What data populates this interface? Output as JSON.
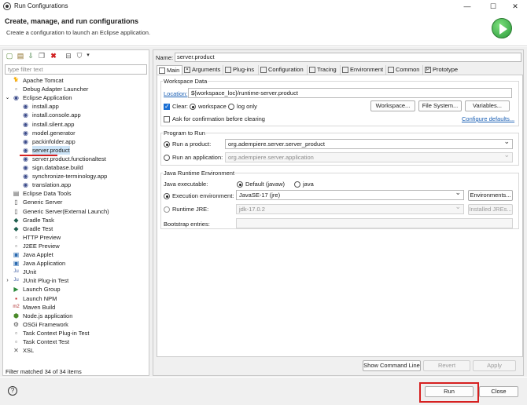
{
  "window": {
    "title": "Run Configurations",
    "controls": [
      "—",
      "☐",
      "✕"
    ]
  },
  "header": {
    "title": "Create, manage, and run configurations",
    "description": "Create a configuration to launch an Eclipse application."
  },
  "left_panel": {
    "filter_placeholder": "type filter text",
    "status": "Filter matched 34 of 34 items",
    "tree": [
      {
        "label": "Apache Tomcat",
        "level": 1,
        "icon": "tomcat-icon",
        "glyph": "🐈"
      },
      {
        "label": "Debug Adapter Launcher",
        "level": 1,
        "icon": "debug-adapter-icon",
        "glyph": "▫"
      },
      {
        "label": "Eclipse Application",
        "level": 1,
        "icon": "eclipse-icon",
        "glyph": "◉",
        "expanded": true
      },
      {
        "label": "install.app",
        "level": 2,
        "icon": "eclipse-icon",
        "glyph": "◉"
      },
      {
        "label": "install.console.app",
        "level": 2,
        "icon": "eclipse-icon",
        "glyph": "◉"
      },
      {
        "label": "install.silent.app",
        "level": 2,
        "icon": "eclipse-icon",
        "glyph": "◉"
      },
      {
        "label": "model.generator",
        "level": 2,
        "icon": "eclipse-icon",
        "glyph": "◉"
      },
      {
        "label": "packinfolder.app",
        "level": 2,
        "icon": "eclipse-icon",
        "glyph": "◉"
      },
      {
        "label": "server.product",
        "level": 2,
        "icon": "eclipse-icon",
        "glyph": "◉",
        "selected": true
      },
      {
        "label": "server.product.functionaltest",
        "level": 2,
        "icon": "eclipse-icon",
        "glyph": "◉"
      },
      {
        "label": "sign.database.build",
        "level": 2,
        "icon": "eclipse-icon",
        "glyph": "◉"
      },
      {
        "label": "synchronize-terminology.app",
        "level": 2,
        "icon": "eclipse-icon",
        "glyph": "◉"
      },
      {
        "label": "translation.app",
        "level": 2,
        "icon": "eclipse-icon",
        "glyph": "◉"
      },
      {
        "label": "Eclipse Data Tools",
        "level": 1,
        "icon": "data-tools-icon",
        "glyph": "▤"
      },
      {
        "label": "Generic Server",
        "level": 1,
        "icon": "server-icon",
        "glyph": "▯"
      },
      {
        "label": "Generic Server(External Launch)",
        "level": 1,
        "icon": "server-icon",
        "glyph": "▯"
      },
      {
        "label": "Gradle Task",
        "level": 1,
        "icon": "gradle-icon",
        "glyph": "◆"
      },
      {
        "label": "Gradle Test",
        "level": 1,
        "icon": "gradle-icon",
        "glyph": "◆"
      },
      {
        "label": "HTTP Preview",
        "level": 1,
        "icon": "http-preview-icon",
        "glyph": "▫"
      },
      {
        "label": "J2EE Preview",
        "level": 1,
        "icon": "j2ee-preview-icon",
        "glyph": "▫"
      },
      {
        "label": "Java Applet",
        "level": 1,
        "icon": "java-applet-icon",
        "glyph": "▣"
      },
      {
        "label": "Java Application",
        "level": 1,
        "icon": "java-app-icon",
        "glyph": "▣"
      },
      {
        "label": "JUnit",
        "level": 1,
        "icon": "junit-icon",
        "glyph": "Ju"
      },
      {
        "label": "JUnit Plug-in Test",
        "level": 1,
        "icon": "junit-plugin-icon",
        "glyph": "Ju",
        "collapsed": true
      },
      {
        "label": "Launch Group",
        "level": 1,
        "icon": "launch-group-icon",
        "glyph": "▶"
      },
      {
        "label": "Launch NPM",
        "level": 1,
        "icon": "npm-icon",
        "glyph": "▪"
      },
      {
        "label": "Maven Build",
        "level": 1,
        "icon": "maven-icon",
        "glyph": "m2"
      },
      {
        "label": "Node.js application",
        "level": 1,
        "icon": "nodejs-icon",
        "glyph": "⬢"
      },
      {
        "label": "OSGi Framework",
        "level": 1,
        "icon": "osgi-icon",
        "glyph": "⚙"
      },
      {
        "label": "Task Context Plug-in Test",
        "level": 1,
        "icon": "task-context-icon",
        "glyph": "▫"
      },
      {
        "label": "Task Context Test",
        "level": 1,
        "icon": "task-context-icon",
        "glyph": "▫"
      },
      {
        "label": "XSL",
        "level": 1,
        "icon": "xsl-icon",
        "glyph": "✕"
      }
    ]
  },
  "right_panel": {
    "name_label": "Name:",
    "name_value": "server.product",
    "tabs": [
      {
        "label": "Main",
        "active": true
      },
      {
        "label": "Arguments"
      },
      {
        "label": "Plug-ins"
      },
      {
        "label": "Configuration"
      },
      {
        "label": "Tracing"
      },
      {
        "label": "Environment"
      },
      {
        "label": "Common"
      },
      {
        "label": "Prototype"
      }
    ],
    "workspace": {
      "group_title": "Workspace Data",
      "location_label": "Location:",
      "location_value": "${workspace_loc}/runtime-server.product",
      "clear_label": "Clear:",
      "workspace_option": "workspace",
      "log_only_option": "log only",
      "btn_workspace": "Workspace...",
      "btn_file_system": "File System...",
      "btn_variables": "Variables...",
      "ask_confirm_label": "Ask for confirmation before clearing",
      "configure_defaults": "Configure defaults..."
    },
    "program": {
      "group_title": "Program to Run",
      "run_product_label": "Run a product:",
      "run_product_value": "org.adempiere.server.server_product",
      "run_application_label": "Run an application:",
      "run_application_value": "org.adempiere.server.application"
    },
    "jre": {
      "group_title": "Java Runtime Environment",
      "java_exec_label": "Java executable:",
      "default_javaw": "Default (javaw)",
      "java_option": "java",
      "exec_env_label": "Execution environment:",
      "exec_env_value": "JavaSE-17 (jre)",
      "btn_environments": "Environments...",
      "runtime_jre_label": "Runtime JRE:",
      "runtime_jre_value": "jdk-17.0.2",
      "btn_installed_jres": "Installed JREs...",
      "bootstrap_label": "Bootstrap entries:"
    },
    "btn_show_command_line": "Show Command Line",
    "btn_revert": "Revert",
    "btn_apply": "Apply"
  },
  "footer": {
    "btn_run": "Run",
    "btn_close": "Close",
    "help_glyph": "?"
  },
  "colors": {
    "highlight": "#d62020",
    "selection": "#cce4f7",
    "link": "#1a5fb4"
  }
}
